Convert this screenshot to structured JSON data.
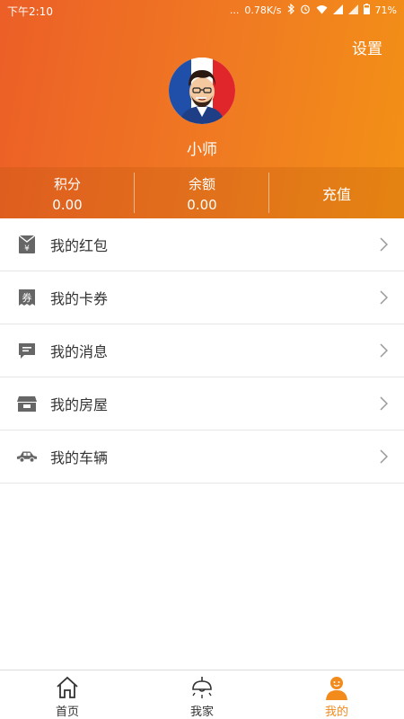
{
  "status_bar": {
    "time": "下午2:10",
    "dots": "...",
    "speed": "0.78K/s",
    "battery": "71%"
  },
  "header": {
    "settings_label": "设置",
    "username": "小师",
    "avatar_icon": "user-avatar"
  },
  "stats": {
    "points_label": "积分",
    "points_value": "0.00",
    "balance_label": "余额",
    "balance_value": "0.00",
    "recharge_label": "充值"
  },
  "menu": {
    "items": [
      {
        "label": "我的红包",
        "icon": "red-packet-icon"
      },
      {
        "label": "我的卡券",
        "icon": "coupon-icon"
      },
      {
        "label": "我的消息",
        "icon": "message-icon"
      },
      {
        "label": "我的房屋",
        "icon": "house-icon"
      },
      {
        "label": "我的车辆",
        "icon": "car-icon"
      }
    ]
  },
  "tabbar": {
    "tabs": [
      {
        "label": "首页",
        "icon": "home-icon",
        "active": false
      },
      {
        "label": "我家",
        "icon": "lamp-icon",
        "active": false
      },
      {
        "label": "我的",
        "icon": "profile-icon",
        "active": true
      }
    ]
  },
  "colors": {
    "accent": "#f28a1c",
    "header_start": "#ec5f27",
    "header_end": "#f39116"
  }
}
